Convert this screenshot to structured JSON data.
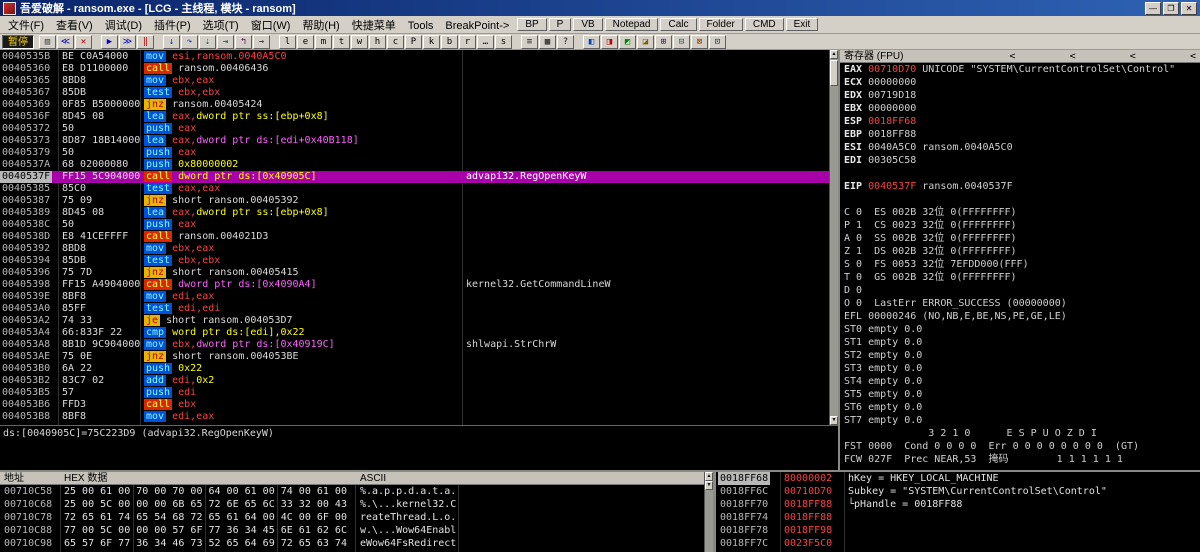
{
  "window": {
    "title": "吾爱破解 - ransom.exe - [LCG -  主线程, 模块 - ransom]",
    "controls": {
      "min": "—",
      "max": "❐",
      "close": "✕"
    }
  },
  "menu": {
    "items": [
      "文件(F)",
      "查看(V)",
      "调试(D)",
      "插件(P)",
      "选项(T)",
      "窗口(W)",
      "帮助(H)",
      "快捷菜单",
      "Tools",
      "BreakPoint->"
    ],
    "buttons": [
      "BP",
      "P",
      "VB",
      "Notepad",
      "Calc",
      "Folder",
      "CMD",
      "Exit"
    ]
  },
  "toolbar": {
    "status": "暂停",
    "buttons": [
      {
        "name": "open-file-icon",
        "g": "▨",
        "c": "#505050"
      },
      {
        "name": "restart-icon",
        "g": "≪",
        "c": "#0000A0"
      },
      {
        "name": "close-program-icon",
        "g": "✕",
        "c": "#A00000"
      },
      {
        "sep": true
      },
      {
        "name": "run-icon",
        "g": "▶",
        "c": "#0000C8"
      },
      {
        "name": "animate-icon",
        "g": "≫",
        "c": "#0000C8"
      },
      {
        "name": "pause-icon",
        "g": "‖",
        "c": "#C00000"
      },
      {
        "sep": true
      },
      {
        "name": "step-into-icon",
        "g": "↓",
        "c": "#0030C0"
      },
      {
        "name": "step-over-icon",
        "g": "↷",
        "c": "#0030C0"
      },
      {
        "name": "trace-into-icon",
        "g": "⇣",
        "c": "#006868"
      },
      {
        "name": "trace-over-icon",
        "g": "⇥",
        "c": "#006868"
      },
      {
        "name": "execute-till-return-icon",
        "g": "↰",
        "c": "#680068"
      },
      {
        "name": "goto-icon",
        "g": "→",
        "c": "#202020"
      },
      {
        "sep": true
      },
      {
        "name": "log-window-button",
        "g": "l",
        "c": "#000000"
      },
      {
        "name": "executables-button",
        "g": "e",
        "c": "#000000"
      },
      {
        "name": "memory-map-button",
        "g": "m",
        "c": "#000000"
      },
      {
        "name": "threads-button",
        "g": "t",
        "c": "#000000"
      },
      {
        "name": "windows-button",
        "g": "w",
        "c": "#000000"
      },
      {
        "name": "handles-button",
        "g": "h",
        "c": "#000000"
      },
      {
        "name": "cpu-button",
        "g": "c",
        "c": "#000000"
      },
      {
        "name": "patches-button",
        "g": "P",
        "c": "#000000"
      },
      {
        "name": "call-stack-button",
        "g": "k",
        "c": "#000000"
      },
      {
        "name": "breakpoints-button",
        "g": "b",
        "c": "#000000"
      },
      {
        "name": "references-button",
        "g": "r",
        "c": "#000000"
      },
      {
        "name": "run-trace-button",
        "g": "…",
        "c": "#000000"
      },
      {
        "name": "source-button",
        "g": "s",
        "c": "#000000"
      },
      {
        "sep": true
      },
      {
        "name": "options-icon",
        "g": "≡",
        "c": "#202020"
      },
      {
        "name": "appearance-icon",
        "g": "▦",
        "c": "#202020"
      },
      {
        "name": "help-icon",
        "g": "?",
        "c": "#202020"
      },
      {
        "sep": true
      },
      {
        "name": "plugin-icon-1",
        "g": "◧",
        "c": "#0040C0"
      },
      {
        "name": "plugin-icon-2",
        "g": "◨",
        "c": "#C00000"
      },
      {
        "name": "plugin-icon-3",
        "g": "◩",
        "c": "#008000"
      },
      {
        "name": "plugin-icon-4",
        "g": "◪",
        "c": "#806000"
      },
      {
        "name": "plugin-icon-5",
        "g": "⊞",
        "c": "#600080"
      },
      {
        "name": "plugin-icon-6",
        "g": "⊟",
        "c": "#006080"
      },
      {
        "name": "plugin-icon-7",
        "g": "⊠",
        "c": "#804000"
      },
      {
        "name": "plugin-icon-8",
        "g": "⊡",
        "c": "#004040"
      }
    ]
  },
  "disasm": {
    "rows": [
      {
        "addr": "0040535B",
        "bytes": "BE C0A54000",
        "mn": "mov",
        "mnc": "b",
        "ops": [
          [
            "esi,ransom.0040A5C0",
            "reg"
          ]
        ]
      },
      {
        "addr": "00405360",
        "bytes": "E8 D1100000",
        "mn": "call",
        "mnc": "c",
        "ops": [
          [
            "ransom.00406436",
            "code"
          ]
        ]
      },
      {
        "addr": "00405365",
        "bytes": "8BD8",
        "mn": "mov",
        "mnc": "b",
        "ops": [
          [
            "ebx,eax",
            "reg"
          ]
        ]
      },
      {
        "addr": "00405367",
        "bytes": "85DB",
        "mn": "test",
        "mnc": "b",
        "ops": [
          [
            "ebx,ebx",
            "reg"
          ]
        ]
      },
      {
        "addr": "00405369",
        "bytes": "0F85 B5000000",
        "mn": "jnz",
        "mnc": "j",
        "ops": [
          [
            "ransom.00405424",
            "code"
          ]
        ]
      },
      {
        "addr": "0040536F",
        "bytes": "8D45 08",
        "mn": "lea",
        "mnc": "b",
        "ops": [
          [
            "eax,",
            "reg"
          ],
          [
            "dword ptr ss:[ebp+0x8]",
            "imm"
          ]
        ]
      },
      {
        "addr": "00405372",
        "bytes": "50",
        "mn": "push",
        "mnc": "b",
        "ops": [
          [
            "eax",
            "reg"
          ]
        ]
      },
      {
        "addr": "00405373",
        "bytes": "8D87 18B14000",
        "mn": "lea",
        "mnc": "b",
        "ops": [
          [
            "eax,",
            "reg"
          ],
          [
            "dword ptr ds:[edi+0x40B118]",
            "mem"
          ]
        ]
      },
      {
        "addr": "00405379",
        "bytes": "50",
        "mn": "push",
        "mnc": "b",
        "ops": [
          [
            "eax",
            "reg"
          ]
        ]
      },
      {
        "addr": "0040537A",
        "bytes": "68 02000080",
        "mn": "push",
        "mnc": "b",
        "ops": [
          [
            "0x80000002",
            "imm"
          ]
        ]
      },
      {
        "addr": "0040537F",
        "bytes": "FF15 5C904000",
        "mn": "call",
        "mnc": "c",
        "ops": [
          [
            "dword ptr ds:[0x40905C]",
            "imm"
          ]
        ],
        "cmt": "advapi32.RegOpenKeyW",
        "sel": true
      },
      {
        "addr": "00405385",
        "bytes": "85C0",
        "mn": "test",
        "mnc": "b",
        "ops": [
          [
            "eax,eax",
            "reg"
          ]
        ]
      },
      {
        "addr": "00405387",
        "bytes": "75 09",
        "mn": "jnz",
        "mnc": "j",
        "ops": [
          [
            "short ransom.00405392",
            "code"
          ]
        ]
      },
      {
        "addr": "00405389",
        "bytes": "8D45 08",
        "mn": "lea",
        "mnc": "b",
        "ops": [
          [
            "eax,",
            "reg"
          ],
          [
            "dword ptr ss:[ebp+0x8]",
            "imm"
          ]
        ]
      },
      {
        "addr": "0040538C",
        "bytes": "50",
        "mn": "push",
        "mnc": "b",
        "ops": [
          [
            "eax",
            "reg"
          ]
        ]
      },
      {
        "addr": "0040538D",
        "bytes": "E8 41CEFFFF",
        "mn": "call",
        "mnc": "c",
        "ops": [
          [
            "ransom.004021D3",
            "code"
          ]
        ]
      },
      {
        "addr": "00405392",
        "bytes": "8BD8",
        "mn": "mov",
        "mnc": "b",
        "ops": [
          [
            "ebx,eax",
            "reg"
          ]
        ]
      },
      {
        "addr": "00405394",
        "bytes": "85DB",
        "mn": "test",
        "mnc": "b",
        "ops": [
          [
            "ebx,ebx",
            "reg"
          ]
        ]
      },
      {
        "addr": "00405396",
        "bytes": "75 7D",
        "mn": "jnz",
        "mnc": "j",
        "ops": [
          [
            "short ransom.00405415",
            "code"
          ]
        ]
      },
      {
        "addr": "00405398",
        "bytes": "FF15 A4904000",
        "mn": "call",
        "mnc": "c",
        "ops": [
          [
            "dword ptr ds:[0x4090A4]",
            "mem"
          ]
        ],
        "cmt": "kernel32.GetCommandLineW"
      },
      {
        "addr": "0040539E",
        "bytes": "8BF8",
        "mn": "mov",
        "mnc": "b",
        "ops": [
          [
            "edi,eax",
            "reg"
          ]
        ]
      },
      {
        "addr": "004053A0",
        "bytes": "85FF",
        "mn": "test",
        "mnc": "b",
        "ops": [
          [
            "edi,edi",
            "reg"
          ]
        ]
      },
      {
        "addr": "004053A2",
        "bytes": "74 33",
        "mn": "je",
        "mnc": "j",
        "ops": [
          [
            "short ransom.004053D7",
            "code"
          ]
        ]
      },
      {
        "addr": "004053A4",
        "bytes": "66:833F 22",
        "mn": "cmp",
        "mnc": "b",
        "ops": [
          [
            "word ptr ds:[edi],0x22",
            "imm"
          ]
        ]
      },
      {
        "addr": "004053A8",
        "bytes": "8B1D 9C904000",
        "mn": "mov",
        "mnc": "b",
        "ops": [
          [
            "ebx,",
            "reg"
          ],
          [
            "dword ptr ds:[0x40919C]",
            "mem"
          ]
        ],
        "cmt": "shlwapi.StrChrW"
      },
      {
        "addr": "004053AE",
        "bytes": "75 0E",
        "mn": "jnz",
        "mnc": "j",
        "ops": [
          [
            "short ransom.004053BE",
            "code"
          ]
        ]
      },
      {
        "addr": "004053B0",
        "bytes": "6A 22",
        "mn": "push",
        "mnc": "b",
        "ops": [
          [
            "0x22",
            "imm"
          ]
        ]
      },
      {
        "addr": "004053B2",
        "bytes": "83C7 02",
        "mn": "add",
        "mnc": "b",
        "ops": [
          [
            "edi,",
            "reg"
          ],
          [
            "0x2",
            "imm"
          ]
        ]
      },
      {
        "addr": "004053B5",
        "bytes": "57",
        "mn": "push",
        "mnc": "b",
        "ops": [
          [
            "edi",
            "reg"
          ]
        ]
      },
      {
        "addr": "004053B6",
        "bytes": "FFD3",
        "mn": "call",
        "mnc": "c",
        "ops": [
          [
            "ebx",
            "reg"
          ]
        ]
      },
      {
        "addr": "004053B8",
        "bytes": "8BF8",
        "mn": "mov",
        "mnc": "b",
        "ops": [
          [
            "edi,eax",
            "reg"
          ]
        ]
      }
    ]
  },
  "registers": {
    "header": "寄存器 (FPU)",
    "arrows": "<         <         <         <",
    "rows": [
      [
        [
          "EAX ",
          "lbl"
        ],
        [
          "00710D70",
          "chg"
        ],
        [
          " UNICODE \"SYSTEM\\CurrentControlSet\\Control\"",
          "txt"
        ]
      ],
      [
        [
          "ECX ",
          "lbl"
        ],
        [
          "00000000",
          "val"
        ]
      ],
      [
        [
          "EDX ",
          "lbl"
        ],
        [
          "00719D18",
          "val"
        ]
      ],
      [
        [
          "EBX ",
          "lbl"
        ],
        [
          "00000000",
          "val"
        ]
      ],
      [
        [
          "ESP ",
          "lbl"
        ],
        [
          "0018FF68",
          "chg"
        ]
      ],
      [
        [
          "EBP ",
          "lbl"
        ],
        [
          "0018FF88",
          "val"
        ]
      ],
      [
        [
          "ESI ",
          "lbl"
        ],
        [
          "0040A5C0",
          "val"
        ],
        [
          " ransom.0040A5C0",
          "txt"
        ]
      ],
      [
        [
          "EDI ",
          "lbl"
        ],
        [
          "00305C58",
          "val"
        ]
      ],
      [],
      [
        [
          "EIP ",
          "lbl"
        ],
        [
          "0040537F",
          "chg"
        ],
        [
          " ransom.0040537F",
          "txt"
        ]
      ],
      [],
      [
        [
          "C 0  ES 002B 32位 0(FFFFFFFF)",
          "txt"
        ]
      ],
      [
        [
          "P 1  CS 0023 32位 0(FFFFFFFF)",
          "txt"
        ]
      ],
      [
        [
          "A 0  SS 002B 32位 0(FFFFFFFF)",
          "txt"
        ]
      ],
      [
        [
          "Z 1  DS 002B 32位 0(FFFFFFFF)",
          "txt"
        ]
      ],
      [
        [
          "S 0  FS 0053 32位 7EFDD000(FFF)",
          "txt"
        ]
      ],
      [
        [
          "T 0  GS 002B 32位 0(FFFFFFFF)",
          "txt"
        ]
      ],
      [
        [
          "D 0",
          "txt"
        ]
      ],
      [
        [
          "O 0  LastErr ERROR_SUCCESS (00000000)",
          "txt"
        ]
      ],
      [
        [
          "EFL 00000246 (NO,NB,E,BE,NS,PE,GE,LE)",
          "txt"
        ]
      ],
      [
        [
          "ST0 empty 0.0",
          "txt"
        ]
      ],
      [
        [
          "ST1 empty 0.0",
          "txt"
        ]
      ],
      [
        [
          "ST2 empty 0.0",
          "txt"
        ]
      ],
      [
        [
          "ST3 empty 0.0",
          "txt"
        ]
      ],
      [
        [
          "ST4 empty 0.0",
          "txt"
        ]
      ],
      [
        [
          "ST5 empty 0.0",
          "txt"
        ]
      ],
      [
        [
          "ST6 empty 0.0",
          "txt"
        ]
      ],
      [
        [
          "ST7 empty 0.0",
          "txt"
        ]
      ],
      [
        [
          "              3 2 1 0      E S P U O Z D I",
          "txt"
        ]
      ],
      [
        [
          "FST 0000  Cond 0 0 0 0  Err 0 0 0 0 0 0 0 0  (GT)",
          "txt"
        ]
      ],
      [
        [
          "FCW 027F  Prec NEAR,53  掩码        1 1 1 1 1 1",
          "txt"
        ]
      ]
    ]
  },
  "info": {
    "text": "ds:[0040905C]=75C223D9 (advapi32.RegOpenKeyW)"
  },
  "dump": {
    "col_addr": "地址",
    "col_hex": "HEX 数据",
    "col_ascii": "ASCII",
    "rows": [
      {
        "addr": "00710C58",
        "hex": "25 00 61 00 70 00 70 00 64 00 61 00 74 00 61 00",
        "ascii": "%.a.p.p.d.a.t.a."
      },
      {
        "addr": "00710C68",
        "hex": "25 00 5C 00 00 00 6B 65 72 6E 65 6C 33 32 00 43",
        "ascii": "%.\\...kernel32.C"
      },
      {
        "addr": "00710C78",
        "hex": "72 65 61 74 65 54 68 72 65 61 64 00 4C 00 6F 00",
        "ascii": "reateThread.L.o."
      },
      {
        "addr": "00710C88",
        "hex": "77 00 5C 00 00 00 57 6F 77 36 34 45 6E 61 62 6C",
        "ascii": "w.\\...Wow64Enabl"
      },
      {
        "addr": "00710C98",
        "hex": "65 57 6F 77 36 34 46 73 52 65 64 69 72 65 63 74",
        "ascii": "eWow64FsRedirect"
      }
    ]
  },
  "stack": {
    "rows": [
      {
        "addr": "0018FF68",
        "value": "80000002",
        "cmt": "hKey = HKEY_LOCAL_MACHINE",
        "esp": true
      },
      {
        "addr": "0018FF6C",
        "value": "00710D70",
        "cmt": "Subkey = \"SYSTEM\\CurrentControlSet\\Control\""
      },
      {
        "addr": "0018FF70",
        "value": "0018FF88",
        "cmt": "└pHandle = 0018FF88"
      },
      {
        "addr": "0018FF74",
        "value": "0018FF88",
        "cmt": ""
      },
      {
        "addr": "0018FF78",
        "value": "0018FF98",
        "cmt": ""
      },
      {
        "addr": "0018FF7C",
        "value": "0023F5C0",
        "cmt": ""
      }
    ]
  }
}
